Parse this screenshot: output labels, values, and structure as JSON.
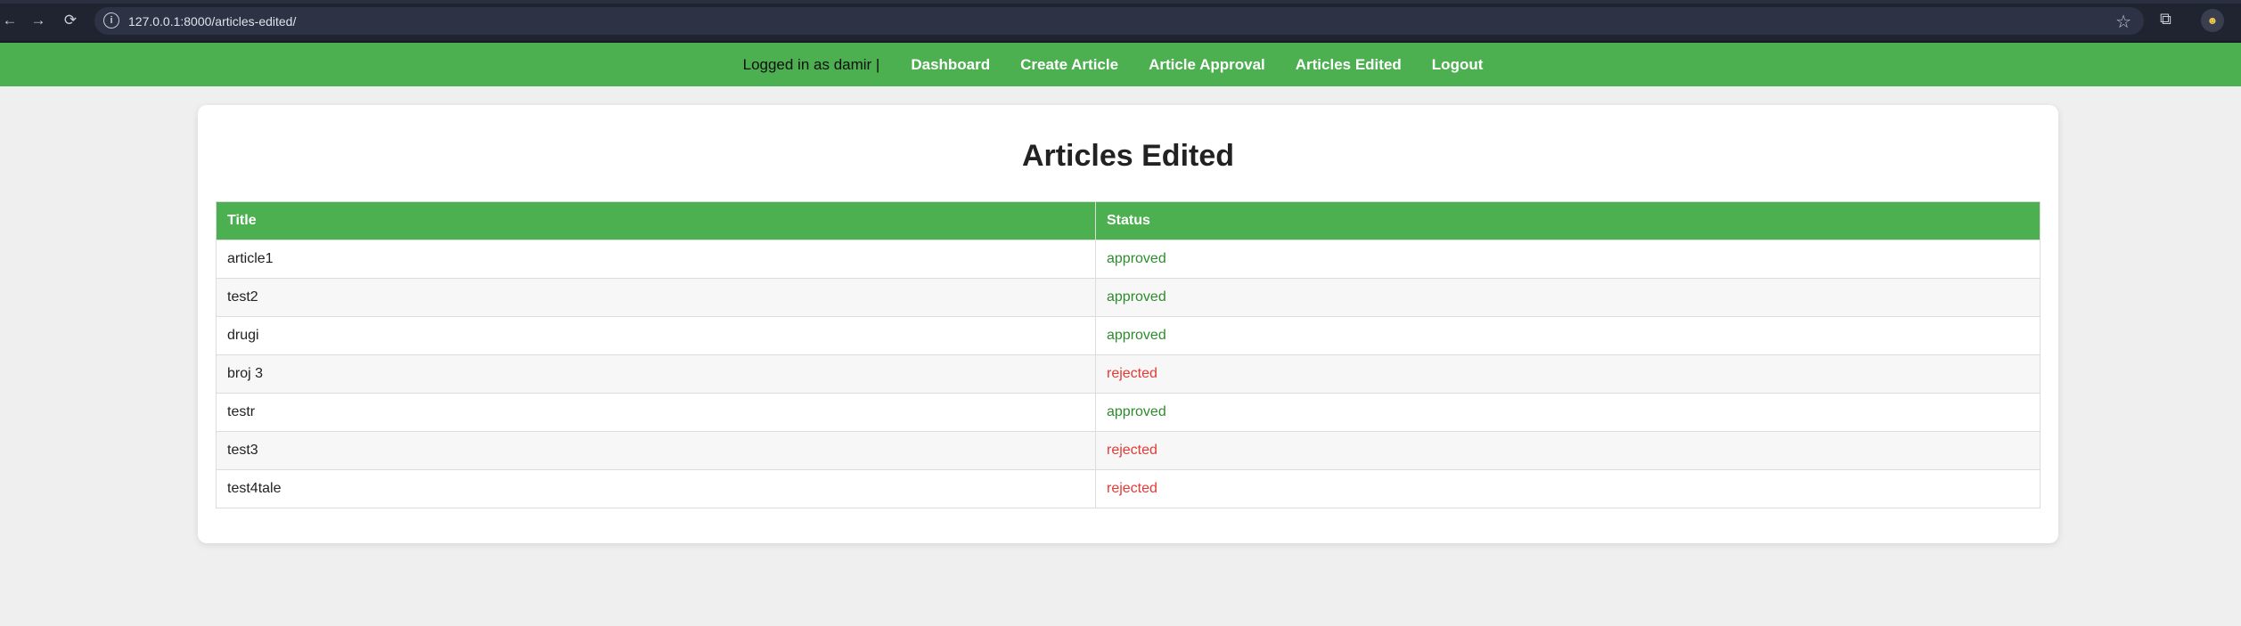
{
  "browser": {
    "url": "127.0.0.1:8000/articles-edited/",
    "back_icon": "←",
    "forward_icon": "→",
    "reload_icon": "⟳",
    "info_icon": "i",
    "star_icon": "☆",
    "extensions_icon": "⧉",
    "avatar_text": "☻"
  },
  "nav": {
    "logged_in_text": "Logged in as damir |",
    "links": [
      "Dashboard",
      "Create Article",
      "Article Approval",
      "Articles Edited",
      "Logout"
    ]
  },
  "page": {
    "title": "Articles Edited"
  },
  "table": {
    "headers": [
      "Title",
      "Status"
    ],
    "rows": [
      {
        "title": "article1",
        "status": "approved"
      },
      {
        "title": "test2",
        "status": "approved"
      },
      {
        "title": "drugi",
        "status": "approved"
      },
      {
        "title": "broj 3",
        "status": "rejected"
      },
      {
        "title": "testr",
        "status": "approved"
      },
      {
        "title": "test3",
        "status": "rejected"
      },
      {
        "title": "test4tale",
        "status": "rejected"
      }
    ]
  },
  "colors": {
    "brand_green": "#4caf50",
    "approved": "#2e8b2e",
    "rejected": "#e53935"
  }
}
